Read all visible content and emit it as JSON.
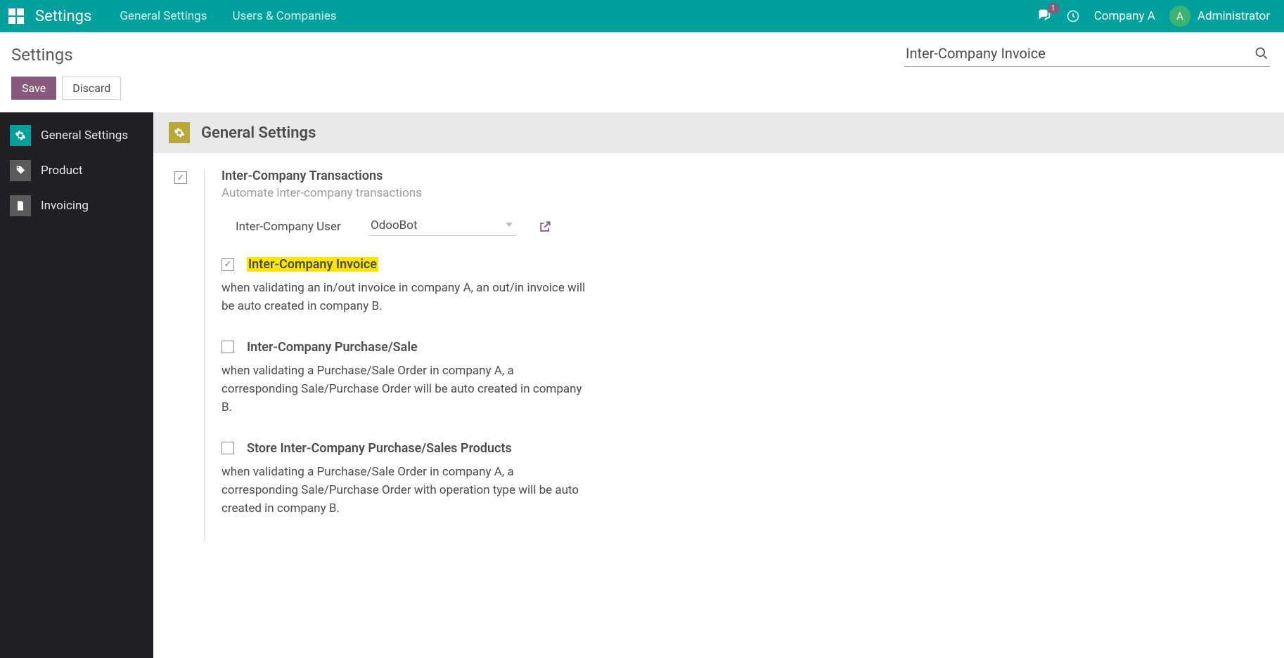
{
  "navbar": {
    "brand": "Settings",
    "links": [
      "General Settings",
      "Users & Companies"
    ],
    "badge": "1",
    "company": "Company A",
    "avatar_initial": "A",
    "user": "Administrator"
  },
  "subheader": {
    "title": "Settings",
    "search_value": "Inter-Company Invoice"
  },
  "actions": {
    "save": "Save",
    "discard": "Discard"
  },
  "sidebar": {
    "items": [
      {
        "label": "General Settings"
      },
      {
        "label": "Product"
      },
      {
        "label": "Invoicing"
      }
    ]
  },
  "section": {
    "title": "General Settings"
  },
  "module": {
    "title": "Inter-Company Transactions",
    "subtitle": "Automate inter-company transactions",
    "user_label": "Inter-Company User",
    "user_value": "OdooBot",
    "options": [
      {
        "checked": true,
        "highlighted": true,
        "title": "Inter-Company Invoice",
        "desc": "when validating an in/out invoice in company A, an out/in invoice will be auto created in company B."
      },
      {
        "checked": false,
        "highlighted": false,
        "title": "Inter-Company Purchase/Sale",
        "desc": "when validating a Purchase/Sale Order in company A, a corresponding Sale/Purchase Order will be auto created in company B."
      },
      {
        "checked": false,
        "highlighted": false,
        "title": "Store Inter-Company Purchase/Sales Products",
        "desc": "when validating a Purchase/Sale Order in company A, a corresponding Sale/Purchase Order with operation type will be auto created in company B."
      }
    ]
  }
}
